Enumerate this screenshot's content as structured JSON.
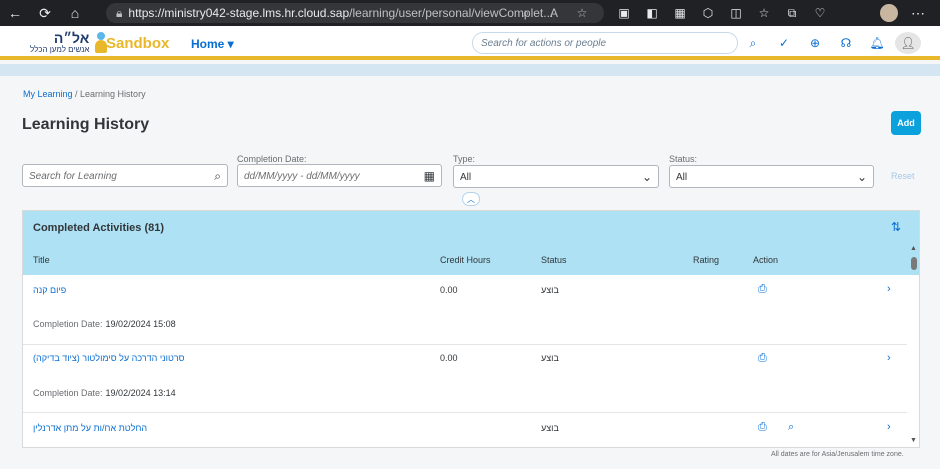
{
  "browser": {
    "url_host": "https://ministry042-stage.lms.hr.cloud.sap",
    "url_path": "/learning/user/personal/viewComplet..."
  },
  "shell": {
    "logo_main": "אל״ה",
    "logo_sub": "אנשים למען הכלל",
    "sandbox": "Sandbox",
    "home_menu": "Home ▾",
    "search_placeholder": "Search for actions or people"
  },
  "breadcrumb": {
    "link": "My Learning",
    "current": " / Learning History"
  },
  "page": {
    "title": "Learning History",
    "add_label": "Add"
  },
  "filters": {
    "search_placeholder": "Search for Learning",
    "date_label": "Completion Date:",
    "date_placeholder": "dd/MM/yyyy - dd/MM/yyyy",
    "type_label": "Type:",
    "type_value": "All",
    "status_label": "Status:",
    "status_value": "All",
    "reset_label": "Reset"
  },
  "table": {
    "title": "Completed Activities (81)",
    "columns": [
      "Title",
      "Credit Hours",
      "Status",
      "Rating",
      "Action"
    ],
    "completion_label": "Completion Date:",
    "rows": [
      {
        "title": "פיום קנה",
        "credit": "0.00",
        "status": "בוצע",
        "completion": "19/02/2024 15:08"
      },
      {
        "title": "סרטוני הדרכה על סימולטור (ציוד בדיקה)",
        "credit": "0.00",
        "status": "בוצע",
        "completion": "19/02/2024 13:14"
      },
      {
        "title": "החלטת אח/ות על מתן אדרנלין",
        "credit": "",
        "status": "בוצע",
        "completion": ""
      }
    ]
  },
  "footer_note": "All dates are for Asia/Jerusalem time zone.",
  "colors": {
    "accent": "#0a6ed1",
    "header_band": "#ade1f3",
    "brand_yellow": "#e9b82a",
    "add_button": "#0aa1dd"
  }
}
